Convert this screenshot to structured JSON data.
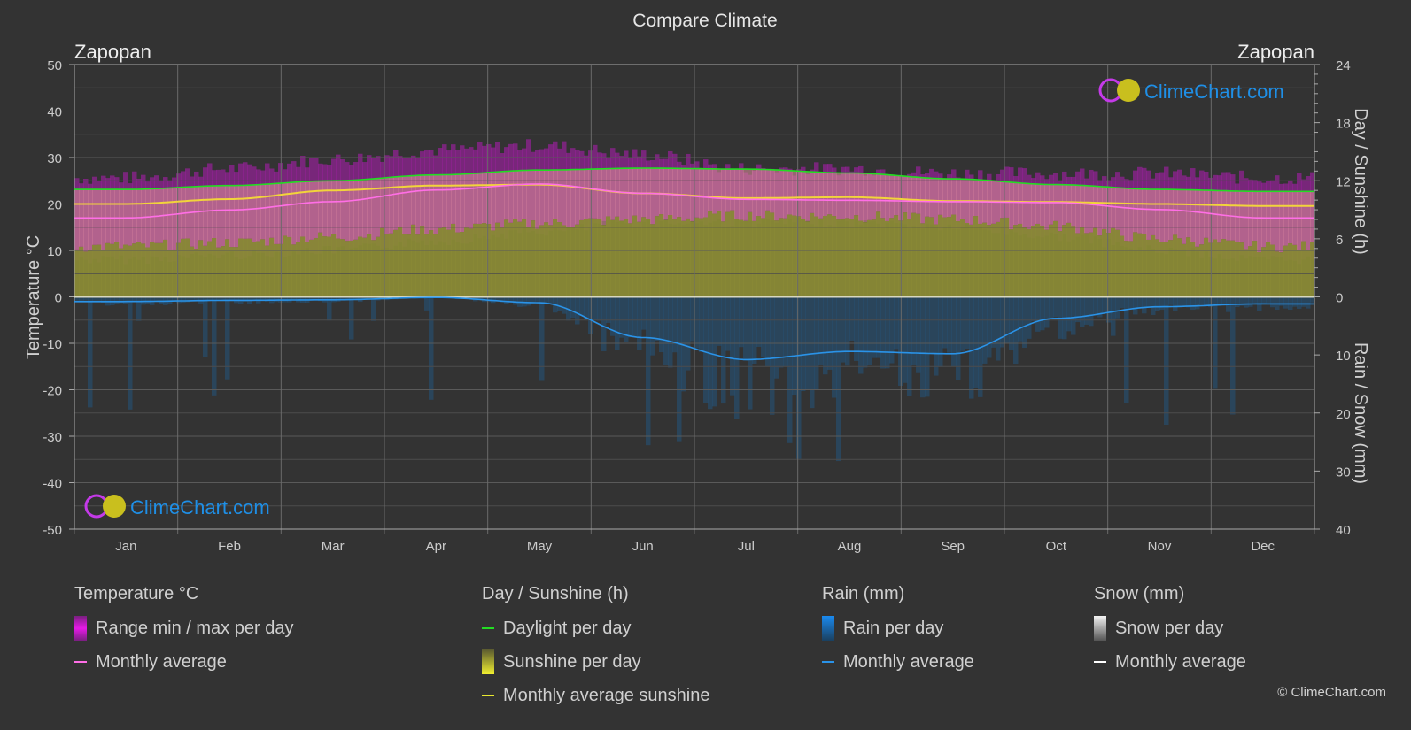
{
  "chart_data": {
    "type": "area",
    "title": "Compare Climate",
    "location_left": "Zapopan",
    "location_right": "Zapopan",
    "categories": [
      "Jan",
      "Feb",
      "Mar",
      "Apr",
      "May",
      "Jun",
      "Jul",
      "Aug",
      "Sep",
      "Oct",
      "Nov",
      "Dec"
    ],
    "axes": {
      "left": {
        "label": "Temperature °C",
        "range": [
          -50,
          50
        ],
        "ticks": [
          50,
          40,
          30,
          20,
          10,
          0,
          -10,
          -20,
          -30,
          -40,
          -50
        ]
      },
      "right_top": {
        "label": "Day / Sunshine (h)",
        "range": [
          0,
          24
        ],
        "ticks": [
          24,
          18,
          12,
          6,
          0
        ]
      },
      "right_bottom": {
        "label": "Rain / Snow (mm)",
        "range": [
          0,
          40
        ],
        "ticks": [
          0,
          10,
          20,
          30,
          40
        ]
      }
    },
    "grid": true,
    "series": [
      {
        "name": "Temperature monthly average",
        "unit": "°C",
        "color": "#ff6ee6",
        "values": [
          17.0,
          18.7,
          20.5,
          23.0,
          24.3,
          22.3,
          21.0,
          20.8,
          20.5,
          20.3,
          18.8,
          17.0
        ]
      },
      {
        "name": "Temperature daily max (approx.)",
        "unit": "°C",
        "values": [
          25,
          27,
          29,
          31,
          32,
          30,
          27,
          27,
          26,
          26,
          26,
          25
        ]
      },
      {
        "name": "Temperature daily min (approx.)",
        "unit": "°C",
        "values": [
          9,
          10,
          11,
          13,
          15,
          17,
          17,
          17,
          16,
          14,
          11,
          9
        ]
      },
      {
        "name": "Daylight per day",
        "unit": "h",
        "color": "#22dd22",
        "values": [
          11.1,
          11.5,
          12.0,
          12.6,
          13.1,
          13.3,
          13.2,
          12.8,
          12.2,
          11.6,
          11.1,
          10.9
        ]
      },
      {
        "name": "Monthly average sunshine",
        "unit": "h",
        "color": "#f2d43a",
        "values": [
          9.6,
          10.1,
          11.0,
          11.5,
          11.6,
          10.7,
          10.2,
          10.3,
          9.9,
          9.8,
          9.6,
          9.4
        ]
      },
      {
        "name": "Sunshine per day (approx.)",
        "unit": "h",
        "values": [
          5.2,
          5.6,
          6.2,
          7.0,
          7.6,
          8.0,
          8.4,
          8.3,
          8.0,
          7.3,
          6.0,
          5.2
        ]
      },
      {
        "name": "Rain monthly average",
        "unit": "mm",
        "color": "#2a93e8",
        "values": [
          0.8,
          0.6,
          0.5,
          0.1,
          1.0,
          7.0,
          10.8,
          9.4,
          9.8,
          3.7,
          1.7,
          1.2
        ]
      },
      {
        "name": "Snow monthly average",
        "unit": "mm",
        "color": "#ffffff",
        "values": [
          0,
          0,
          0,
          0,
          0,
          0,
          0,
          0,
          0,
          0,
          0,
          0
        ]
      }
    ],
    "watermark": "ClimeChart.com"
  },
  "legend": {
    "temperature": {
      "head": "Temperature °C",
      "range": "Range min / max per day",
      "avg": "Monthly average"
    },
    "sun": {
      "head": "Day / Sunshine (h)",
      "daylight": "Daylight per day",
      "sunshine": "Sunshine per day",
      "avg": "Monthly average sunshine"
    },
    "rain": {
      "head": "Rain (mm)",
      "per_day": "Rain per day",
      "avg": "Monthly average"
    },
    "snow": {
      "head": "Snow (mm)",
      "per_day": "Snow per day",
      "avg": "Monthly average"
    }
  },
  "copyright": "© ClimeChart.com"
}
